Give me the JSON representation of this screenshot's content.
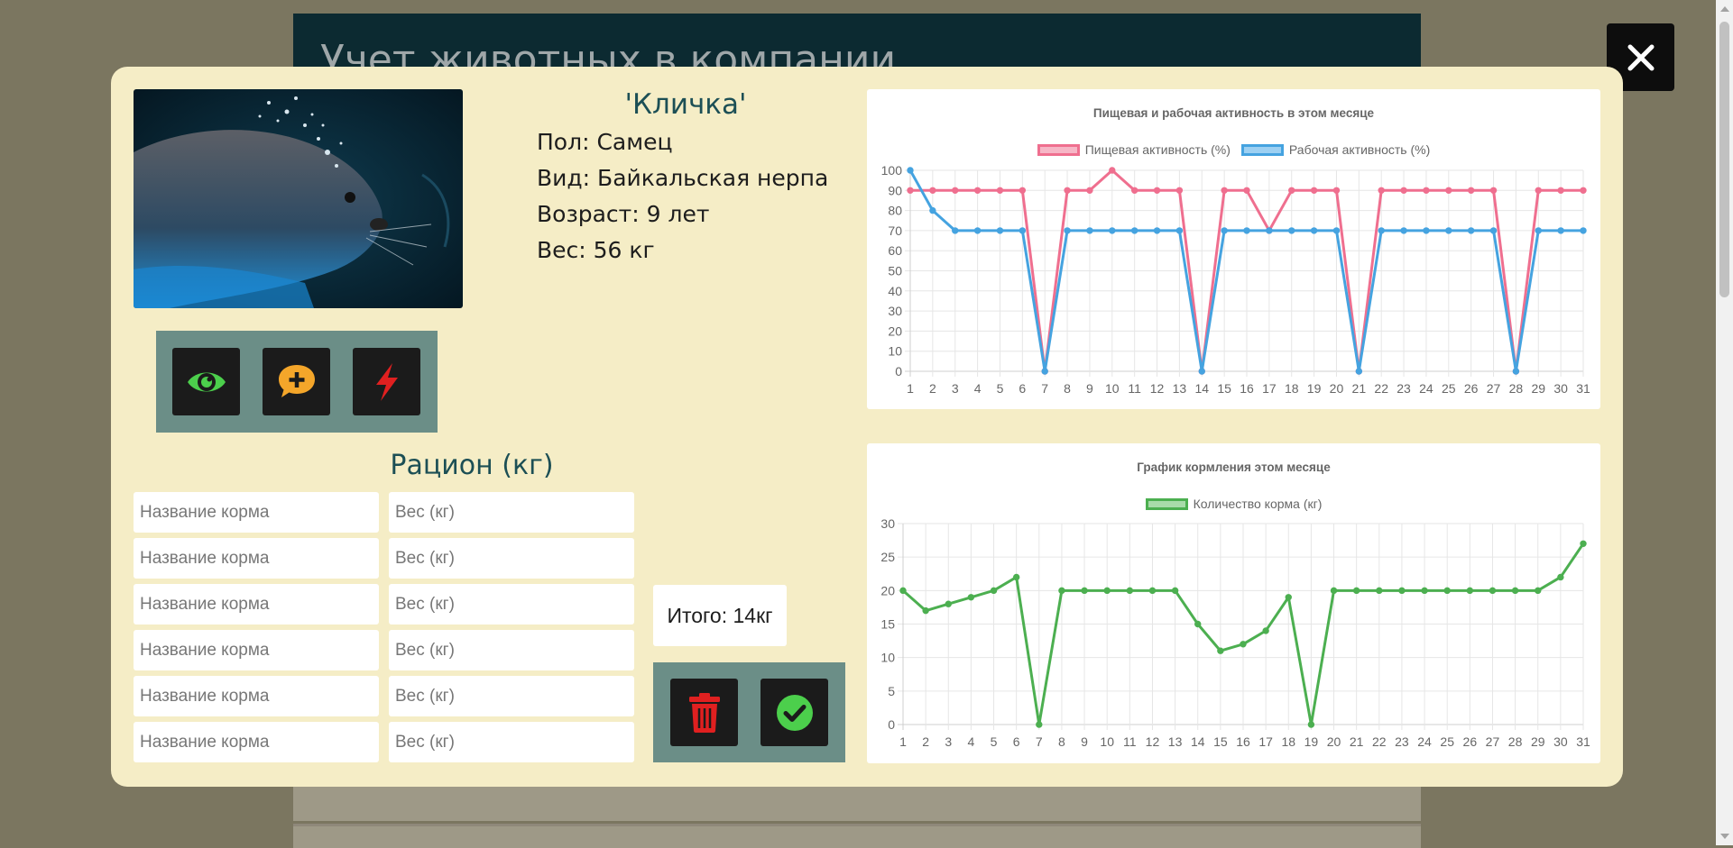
{
  "background": {
    "title": "Учет животных в компании"
  },
  "modal": {
    "close_icon": "close-icon",
    "animal": {
      "name": "'Кличка'",
      "sex": "Пол: Самец",
      "species": "Вид: Байкальская нерпа",
      "age": "Возраст: 9 лет",
      "weight": "Вес: 56 кг",
      "photo_alt": "Байкальская нерпа под водой"
    },
    "actions": [
      {
        "icon": "eye-icon",
        "color": "#4ccf4c"
      },
      {
        "icon": "comment-plus-icon",
        "color": "#f4a62a"
      },
      {
        "icon": "lightning-icon",
        "color": "#e02020"
      }
    ],
    "ration": {
      "title": "Рацион (кг)",
      "rows": [
        {
          "name_placeholder": "Название корма",
          "weight_placeholder": "Вес (кг)"
        },
        {
          "name_placeholder": "Название корма",
          "weight_placeholder": "Вес (кг)"
        },
        {
          "name_placeholder": "Название корма",
          "weight_placeholder": "Вес (кг)"
        },
        {
          "name_placeholder": "Название корма",
          "weight_placeholder": "Вес (кг)"
        },
        {
          "name_placeholder": "Название корма",
          "weight_placeholder": "Вес (кг)"
        },
        {
          "name_placeholder": "Название корма",
          "weight_placeholder": "Вес (кг)"
        }
      ],
      "total": "Итого: 14кг",
      "delete_icon": "trash-icon",
      "confirm_icon": "check-circle-icon"
    }
  },
  "chart_data": [
    {
      "type": "line",
      "title": "Пищевая и рабочая активность в этом месяце",
      "x": [
        1,
        2,
        3,
        4,
        5,
        6,
        7,
        8,
        9,
        10,
        11,
        12,
        13,
        14,
        15,
        16,
        17,
        18,
        19,
        20,
        21,
        22,
        23,
        24,
        25,
        26,
        27,
        28,
        29,
        30,
        31
      ],
      "ylim": [
        0,
        100
      ],
      "yticks": [
        0,
        10,
        20,
        30,
        40,
        50,
        60,
        70,
        80,
        90,
        100
      ],
      "legend_position": "top",
      "grid": true,
      "series": [
        {
          "name": "Пищевая активность (%)",
          "color": "#ef6f8f",
          "values": [
            90,
            90,
            90,
            90,
            90,
            90,
            0,
            90,
            90,
            100,
            90,
            90,
            90,
            0,
            90,
            90,
            70,
            90,
            90,
            90,
            0,
            90,
            90,
            90,
            90,
            90,
            90,
            0,
            90,
            90,
            90
          ]
        },
        {
          "name": "Рабочая активность (%)",
          "color": "#45a3e0",
          "values": [
            100,
            80,
            70,
            70,
            70,
            70,
            0,
            70,
            70,
            70,
            70,
            70,
            70,
            0,
            70,
            70,
            70,
            70,
            70,
            70,
            0,
            70,
            70,
            70,
            70,
            70,
            70,
            0,
            70,
            70,
            70
          ]
        }
      ]
    },
    {
      "type": "line",
      "title": "График кормления этом месяце",
      "x": [
        1,
        2,
        3,
        4,
        5,
        6,
        7,
        8,
        9,
        10,
        11,
        12,
        13,
        14,
        15,
        16,
        17,
        18,
        19,
        20,
        21,
        22,
        23,
        24,
        25,
        26,
        27,
        28,
        29,
        30,
        31
      ],
      "ylim": [
        0,
        30
      ],
      "yticks": [
        0,
        5,
        10,
        15,
        20,
        25,
        30
      ],
      "legend_position": "top",
      "grid": true,
      "series": [
        {
          "name": "Количество корма (кг)",
          "color": "#4caf50",
          "values": [
            20,
            17,
            18,
            19,
            20,
            22,
            0,
            20,
            20,
            20,
            20,
            20,
            20,
            15,
            11,
            12,
            14,
            19,
            0,
            20,
            20,
            20,
            20,
            20,
            20,
            20,
            20,
            20,
            20,
            22,
            27
          ]
        }
      ]
    }
  ]
}
